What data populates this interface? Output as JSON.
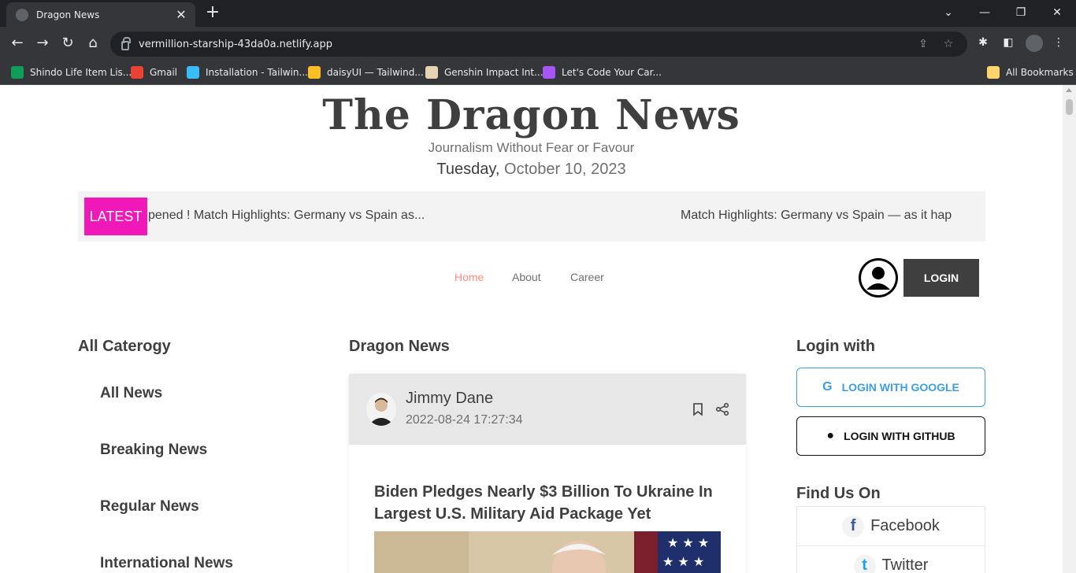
{
  "browser": {
    "tab_title": "Dragon News",
    "tab_close": "✕",
    "new_tab": "+",
    "url": "vermillion-starship-43da0a.netlify.app",
    "bookmarks": [
      {
        "label": "Shindo Life Item Lis...",
        "color": "#0f9d58"
      },
      {
        "label": "Gmail",
        "color": "#ea4335"
      },
      {
        "label": "Installation - Tailwin...",
        "color": "#38bdf8"
      },
      {
        "label": "daisyUI — Tailwind...",
        "color": "#fbbf24"
      },
      {
        "label": "Genshin Impact Int...",
        "color": "#e5d3b3"
      },
      {
        "label": "Let's Code Your Car...",
        "color": "#a855f7"
      }
    ],
    "all_bookmarks": "All Bookmarks"
  },
  "header": {
    "logo": "The Dragon News",
    "tagline": "Journalism Without Fear or Favour",
    "day": "Tuesday,",
    "date": "October 10, 2023"
  },
  "marquee": {
    "badge": "LATEST",
    "text_1": "pened ! Match Highlights: Germany vs Spain as...",
    "text_2": "Match Highlights: Germany vs Spain — as it hap"
  },
  "nav": {
    "home": "Home",
    "about": "About",
    "career": "Career",
    "login": "LOGIN",
    "active_color": "#ff8c7f"
  },
  "left": {
    "title": "All Caterogy",
    "categories": [
      "All News",
      "Breaking News",
      "Regular News",
      "International News"
    ]
  },
  "center": {
    "title": "Dragon News",
    "card": {
      "author": "Jimmy Dane",
      "date": "2022-08-24 17:27:34",
      "title": "Biden Pledges Nearly $3 Billion To Ukraine In Largest U.S. Military Aid Package Yet"
    }
  },
  "right": {
    "login_title": "Login with",
    "google": "LOGIN WITH GOOGLE",
    "github": "LOGIN WITH GITHUB",
    "find_title": "Find Us On",
    "facebook": "Facebook",
    "twitter": "Twitter"
  }
}
